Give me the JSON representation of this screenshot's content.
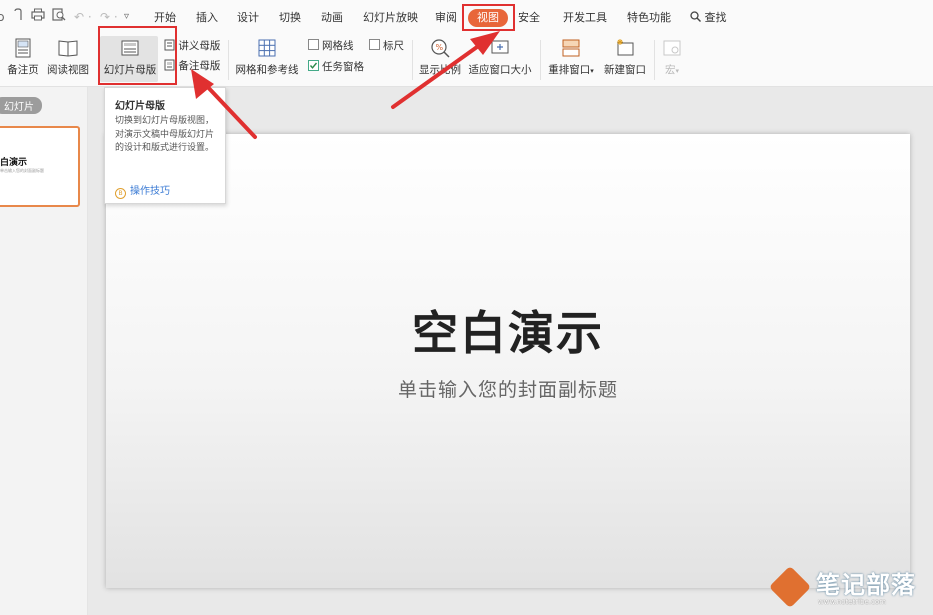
{
  "menubar": {
    "tabs": [
      {
        "label": "开始"
      },
      {
        "label": "插入"
      },
      {
        "label": "设计"
      },
      {
        "label": "切换"
      },
      {
        "label": "动画"
      },
      {
        "label": "幻灯片放映"
      },
      {
        "label": "审阅"
      },
      {
        "label": "视图"
      },
      {
        "label": "安全"
      },
      {
        "label": "开发工具"
      },
      {
        "label": "特色功能"
      }
    ],
    "search_label": "查找",
    "active_tab": "视图",
    "active_color": "#e8663a"
  },
  "ribbon": {
    "notes_page": "备注页",
    "reading_view": "阅读视图",
    "slide_master": "幻灯片母版",
    "handout_master": "讲义母版",
    "notes_master": "备注母版",
    "grid_guides": "网格和参考线",
    "gridlines": "网格线",
    "ruler": "标尺",
    "task_pane": "任务窗格",
    "zoom": "显示比例",
    "fit_window": "适应窗口大小",
    "arrange_windows": "重排窗口",
    "new_window": "新建窗口",
    "macro": "宏"
  },
  "left_panel": {
    "tab_label": "幻灯片",
    "thumb_title": "白演示",
    "thumb_subtitle": "单击输入您的封面副标题"
  },
  "slide": {
    "title": "空白演示",
    "subtitle": "单击输入您的封面副标题"
  },
  "tooltip": {
    "title": "幻灯片母版",
    "body": "切换到幻灯片母版视图，对演示文稿中母版幻灯片的设计和版式进行设置。",
    "link": "操作技巧"
  },
  "watermark": {
    "name": "笔记部落",
    "url": "www.notetribe.com"
  },
  "colors": {
    "annotation_red": "#e03030",
    "thumb_border": "#e8884a"
  }
}
